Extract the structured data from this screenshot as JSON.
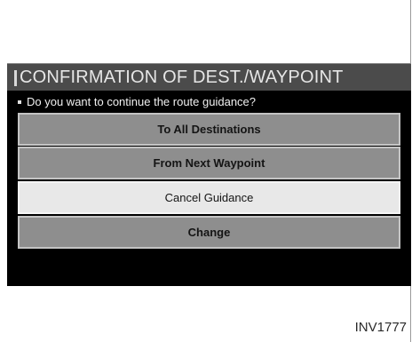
{
  "dialog": {
    "title": "CONFIRMATION OF DEST./WAYPOINT",
    "question": "Do you want to continue the route guidance?",
    "options": [
      {
        "label": "To All Destinations",
        "selected": false
      },
      {
        "label": "From Next Waypoint",
        "selected": false
      },
      {
        "label": "Cancel Guidance",
        "selected": true
      },
      {
        "label": "Change",
        "selected": false
      }
    ]
  },
  "figure": {
    "code": "INV1777"
  },
  "colors": {
    "screen_background": "#000000",
    "title_bar": "#4b4b4b",
    "option_normal": "#8e8e8e",
    "option_selected": "#e8e8e8"
  }
}
